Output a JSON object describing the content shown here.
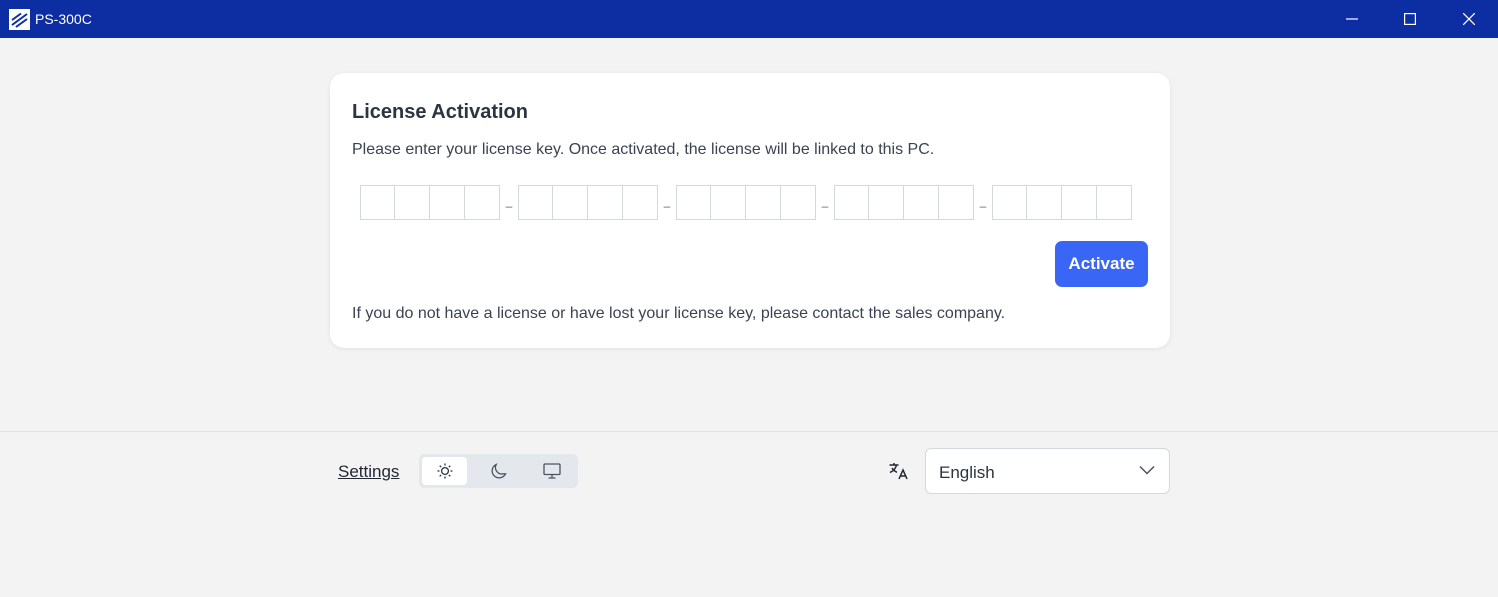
{
  "window": {
    "title": "PS-300C",
    "icon": "app-logo-icon",
    "controls": [
      "minimize-icon",
      "maximize-icon",
      "close-icon"
    ]
  },
  "license": {
    "title": "License Activation",
    "description": "Please enter your license key. Once activated, the license will be linked to this PC.",
    "key_groups": [
      [
        "",
        "",
        "",
        ""
      ],
      [
        "",
        "",
        "",
        ""
      ],
      [
        "",
        "",
        "",
        ""
      ],
      [
        "",
        "",
        "",
        ""
      ],
      [
        "",
        "",
        "",
        ""
      ]
    ],
    "separator": "–",
    "activate_label": "Activate",
    "note": "If you do not have a license or have lost your license key, please contact the sales company."
  },
  "footer": {
    "settings_label": "Settings",
    "theme_options": [
      {
        "icon": "sun-icon",
        "selected": true
      },
      {
        "icon": "moon-icon",
        "selected": false
      },
      {
        "icon": "monitor-icon",
        "selected": false
      }
    ],
    "language_icon": "translate-icon",
    "language_value": "English"
  },
  "colors": {
    "titlebar": "#0d2da3",
    "accent": "#3a66f5",
    "background": "#f3f3f3",
    "card": "#ffffff"
  }
}
